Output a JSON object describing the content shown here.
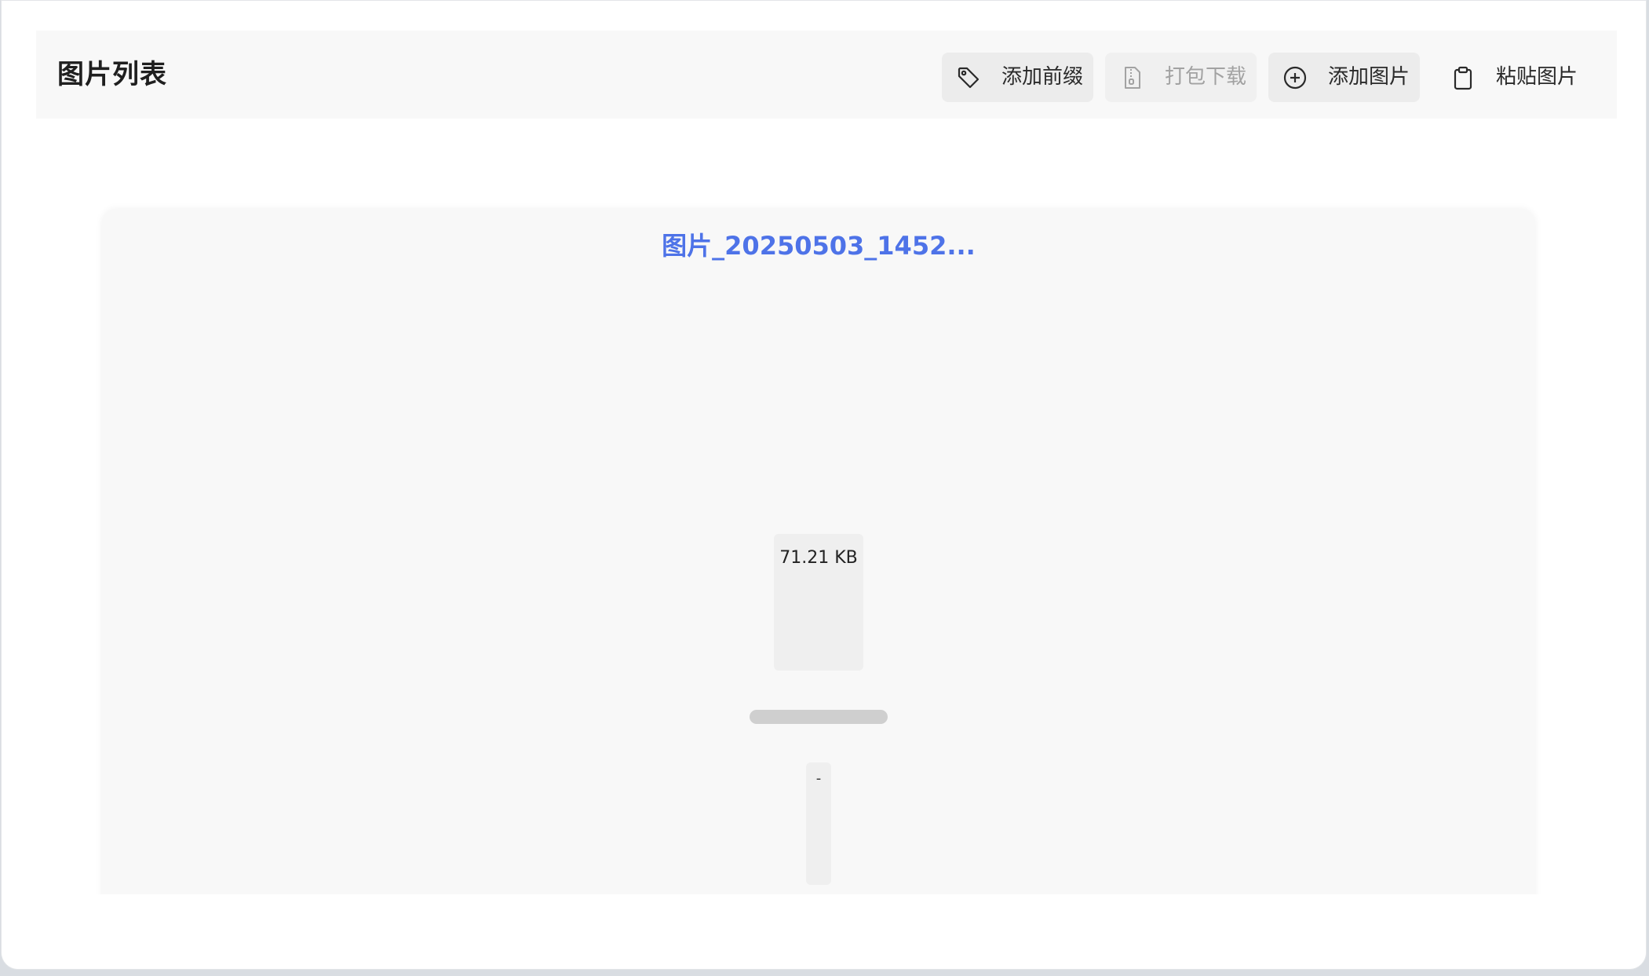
{
  "header": {
    "title": "图片列表",
    "buttons": {
      "add_prefix": {
        "label": "添加前缀",
        "icon": "tag-icon"
      },
      "pack_download": {
        "label": "打包下载",
        "icon": "zip-file-icon",
        "disabled": true
      },
      "add_image": {
        "label": "添加图片",
        "icon": "plus-circle-icon"
      },
      "paste_image": {
        "label": "粘贴图片",
        "icon": "clipboard-icon"
      }
    }
  },
  "card": {
    "file_name": "图片_20250503_1452...",
    "size": "71.21 KB",
    "progress_fraction": 1.0,
    "status": "-"
  },
  "colors": {
    "accent": "#4e73e8",
    "header_bg": "#f8f8f8",
    "button_bg": "#ececec"
  }
}
